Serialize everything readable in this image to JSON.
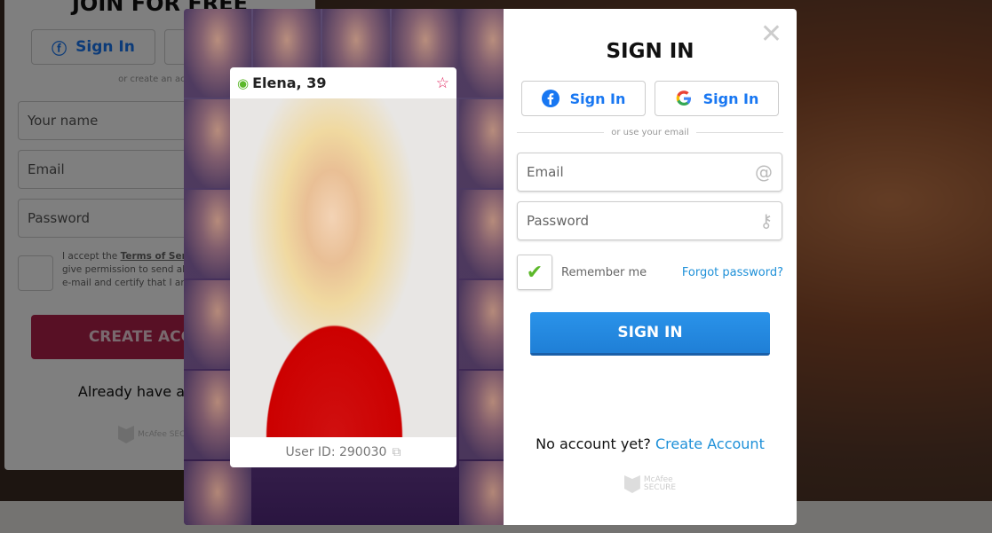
{
  "background_form": {
    "title": "JOIN FOR FREE",
    "facebook_label": "Sign In",
    "separator": "or create an account",
    "name_placeholder": "Your name",
    "email_placeholder": "Email",
    "password_placeholder": "Password",
    "terms_line1": "I accept the ",
    "terms_link": "Terms of Service",
    "terms_line2": "give permission to send alerts",
    "terms_line3": "e-mail and certify that I am",
    "create_button": "CREATE ACCOUNT",
    "already": "Already have a profile?",
    "badge": "McAfee SECURE"
  },
  "profile": {
    "name": "Elena, 39",
    "user_id": "User ID: 290030",
    "status_color": "#5cb82a"
  },
  "signin": {
    "title": "SIGN IN",
    "facebook_label": "Sign In",
    "google_label": "Sign In",
    "separator": "or use your email",
    "email_placeholder": "Email",
    "password_placeholder": "Password",
    "remember_label": "Remember me",
    "remember_checked": true,
    "forgot_label": "Forgot password?",
    "submit_label": "SIGN IN",
    "no_account": "No account yet?",
    "create_link": "Create Account",
    "badge_line1": "McAfee",
    "badge_line2": "SECURE",
    "accent_color": "#1e90d8"
  }
}
